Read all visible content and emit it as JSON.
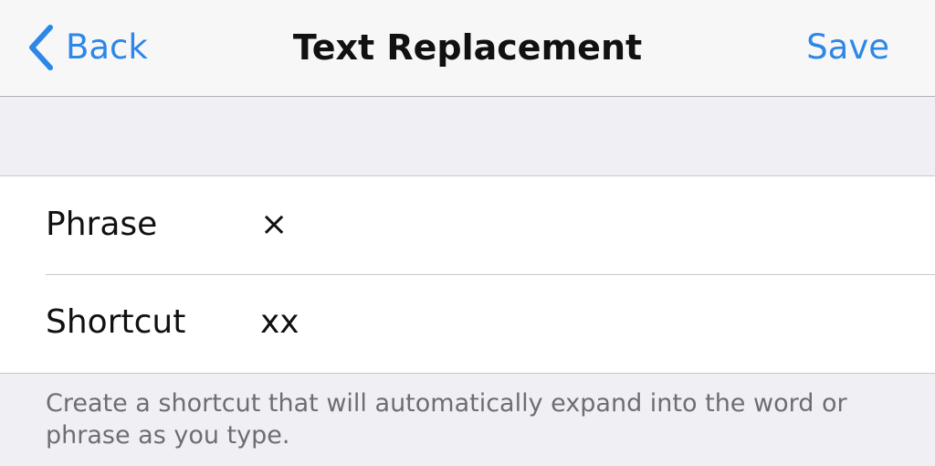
{
  "navbar": {
    "back_label": "Back",
    "title": "Text Replacement",
    "save_label": "Save",
    "accent_color": "#2d87e8",
    "back_icon": "chevron-left-icon"
  },
  "form": {
    "rows": [
      {
        "label": "Phrase",
        "value": "×"
      },
      {
        "label": "Shortcut",
        "value": "xx"
      }
    ]
  },
  "footer": {
    "note": "Create a shortcut that will automatically expand into the word or phrase as you type."
  }
}
